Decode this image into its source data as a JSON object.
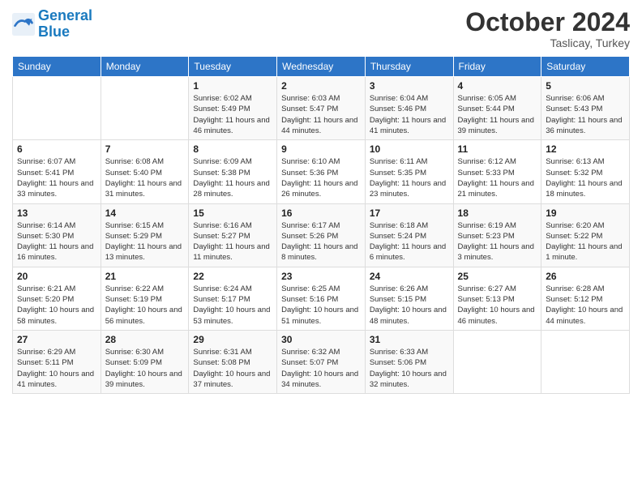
{
  "logo": {
    "line1": "General",
    "line2": "Blue"
  },
  "title": "October 2024",
  "location": "Taslicay, Turkey",
  "headers": [
    "Sunday",
    "Monday",
    "Tuesday",
    "Wednesday",
    "Thursday",
    "Friday",
    "Saturday"
  ],
  "weeks": [
    [
      {
        "day": "",
        "sunrise": "",
        "sunset": "",
        "daylight": ""
      },
      {
        "day": "",
        "sunrise": "",
        "sunset": "",
        "daylight": ""
      },
      {
        "day": "1",
        "sunrise": "Sunrise: 6:02 AM",
        "sunset": "Sunset: 5:49 PM",
        "daylight": "Daylight: 11 hours and 46 minutes."
      },
      {
        "day": "2",
        "sunrise": "Sunrise: 6:03 AM",
        "sunset": "Sunset: 5:47 PM",
        "daylight": "Daylight: 11 hours and 44 minutes."
      },
      {
        "day": "3",
        "sunrise": "Sunrise: 6:04 AM",
        "sunset": "Sunset: 5:46 PM",
        "daylight": "Daylight: 11 hours and 41 minutes."
      },
      {
        "day": "4",
        "sunrise": "Sunrise: 6:05 AM",
        "sunset": "Sunset: 5:44 PM",
        "daylight": "Daylight: 11 hours and 39 minutes."
      },
      {
        "day": "5",
        "sunrise": "Sunrise: 6:06 AM",
        "sunset": "Sunset: 5:43 PM",
        "daylight": "Daylight: 11 hours and 36 minutes."
      }
    ],
    [
      {
        "day": "6",
        "sunrise": "Sunrise: 6:07 AM",
        "sunset": "Sunset: 5:41 PM",
        "daylight": "Daylight: 11 hours and 33 minutes."
      },
      {
        "day": "7",
        "sunrise": "Sunrise: 6:08 AM",
        "sunset": "Sunset: 5:40 PM",
        "daylight": "Daylight: 11 hours and 31 minutes."
      },
      {
        "day": "8",
        "sunrise": "Sunrise: 6:09 AM",
        "sunset": "Sunset: 5:38 PM",
        "daylight": "Daylight: 11 hours and 28 minutes."
      },
      {
        "day": "9",
        "sunrise": "Sunrise: 6:10 AM",
        "sunset": "Sunset: 5:36 PM",
        "daylight": "Daylight: 11 hours and 26 minutes."
      },
      {
        "day": "10",
        "sunrise": "Sunrise: 6:11 AM",
        "sunset": "Sunset: 5:35 PM",
        "daylight": "Daylight: 11 hours and 23 minutes."
      },
      {
        "day": "11",
        "sunrise": "Sunrise: 6:12 AM",
        "sunset": "Sunset: 5:33 PM",
        "daylight": "Daylight: 11 hours and 21 minutes."
      },
      {
        "day": "12",
        "sunrise": "Sunrise: 6:13 AM",
        "sunset": "Sunset: 5:32 PM",
        "daylight": "Daylight: 11 hours and 18 minutes."
      }
    ],
    [
      {
        "day": "13",
        "sunrise": "Sunrise: 6:14 AM",
        "sunset": "Sunset: 5:30 PM",
        "daylight": "Daylight: 11 hours and 16 minutes."
      },
      {
        "day": "14",
        "sunrise": "Sunrise: 6:15 AM",
        "sunset": "Sunset: 5:29 PM",
        "daylight": "Daylight: 11 hours and 13 minutes."
      },
      {
        "day": "15",
        "sunrise": "Sunrise: 6:16 AM",
        "sunset": "Sunset: 5:27 PM",
        "daylight": "Daylight: 11 hours and 11 minutes."
      },
      {
        "day": "16",
        "sunrise": "Sunrise: 6:17 AM",
        "sunset": "Sunset: 5:26 PM",
        "daylight": "Daylight: 11 hours and 8 minutes."
      },
      {
        "day": "17",
        "sunrise": "Sunrise: 6:18 AM",
        "sunset": "Sunset: 5:24 PM",
        "daylight": "Daylight: 11 hours and 6 minutes."
      },
      {
        "day": "18",
        "sunrise": "Sunrise: 6:19 AM",
        "sunset": "Sunset: 5:23 PM",
        "daylight": "Daylight: 11 hours and 3 minutes."
      },
      {
        "day": "19",
        "sunrise": "Sunrise: 6:20 AM",
        "sunset": "Sunset: 5:22 PM",
        "daylight": "Daylight: 11 hours and 1 minute."
      }
    ],
    [
      {
        "day": "20",
        "sunrise": "Sunrise: 6:21 AM",
        "sunset": "Sunset: 5:20 PM",
        "daylight": "Daylight: 10 hours and 58 minutes."
      },
      {
        "day": "21",
        "sunrise": "Sunrise: 6:22 AM",
        "sunset": "Sunset: 5:19 PM",
        "daylight": "Daylight: 10 hours and 56 minutes."
      },
      {
        "day": "22",
        "sunrise": "Sunrise: 6:24 AM",
        "sunset": "Sunset: 5:17 PM",
        "daylight": "Daylight: 10 hours and 53 minutes."
      },
      {
        "day": "23",
        "sunrise": "Sunrise: 6:25 AM",
        "sunset": "Sunset: 5:16 PM",
        "daylight": "Daylight: 10 hours and 51 minutes."
      },
      {
        "day": "24",
        "sunrise": "Sunrise: 6:26 AM",
        "sunset": "Sunset: 5:15 PM",
        "daylight": "Daylight: 10 hours and 48 minutes."
      },
      {
        "day": "25",
        "sunrise": "Sunrise: 6:27 AM",
        "sunset": "Sunset: 5:13 PM",
        "daylight": "Daylight: 10 hours and 46 minutes."
      },
      {
        "day": "26",
        "sunrise": "Sunrise: 6:28 AM",
        "sunset": "Sunset: 5:12 PM",
        "daylight": "Daylight: 10 hours and 44 minutes."
      }
    ],
    [
      {
        "day": "27",
        "sunrise": "Sunrise: 6:29 AM",
        "sunset": "Sunset: 5:11 PM",
        "daylight": "Daylight: 10 hours and 41 minutes."
      },
      {
        "day": "28",
        "sunrise": "Sunrise: 6:30 AM",
        "sunset": "Sunset: 5:09 PM",
        "daylight": "Daylight: 10 hours and 39 minutes."
      },
      {
        "day": "29",
        "sunrise": "Sunrise: 6:31 AM",
        "sunset": "Sunset: 5:08 PM",
        "daylight": "Daylight: 10 hours and 37 minutes."
      },
      {
        "day": "30",
        "sunrise": "Sunrise: 6:32 AM",
        "sunset": "Sunset: 5:07 PM",
        "daylight": "Daylight: 10 hours and 34 minutes."
      },
      {
        "day": "31",
        "sunrise": "Sunrise: 6:33 AM",
        "sunset": "Sunset: 5:06 PM",
        "daylight": "Daylight: 10 hours and 32 minutes."
      },
      {
        "day": "",
        "sunrise": "",
        "sunset": "",
        "daylight": ""
      },
      {
        "day": "",
        "sunrise": "",
        "sunset": "",
        "daylight": ""
      }
    ]
  ]
}
